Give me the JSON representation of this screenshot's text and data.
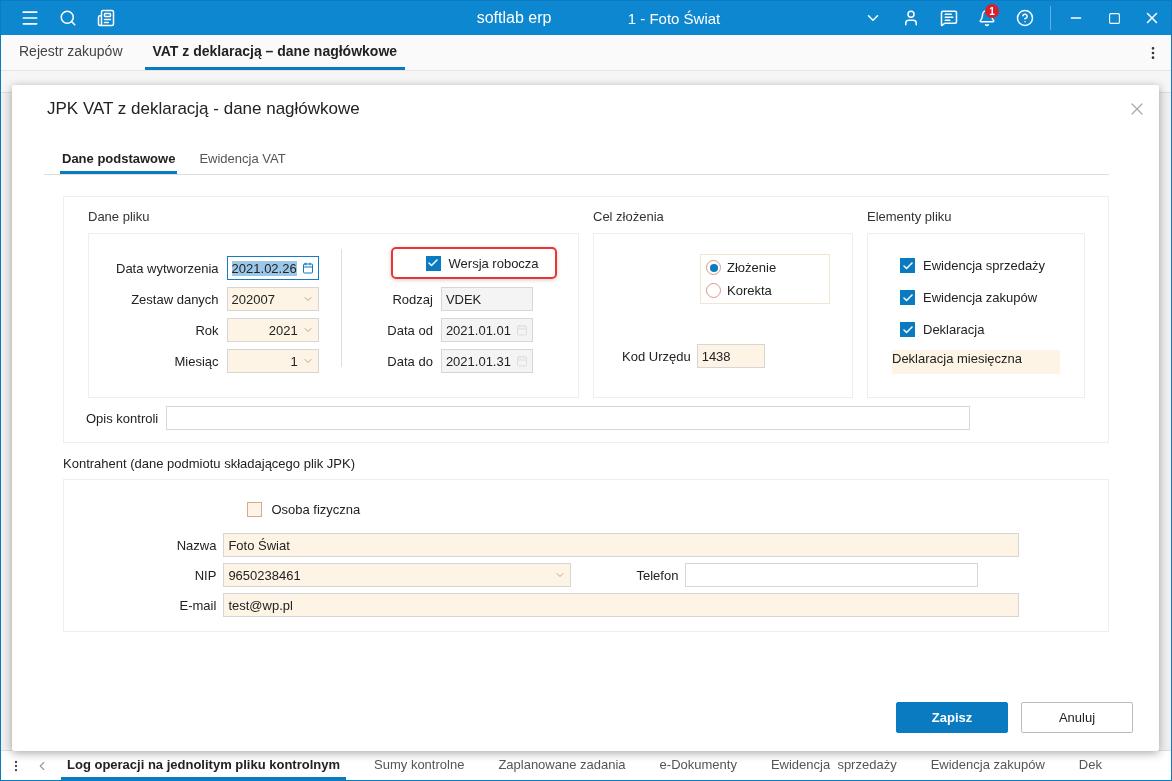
{
  "app": {
    "title": "softlab erp",
    "company": "1 - Foto Świat",
    "notification_count": "1"
  },
  "tabs": [
    {
      "label": "Rejestr zakupów",
      "selected": false
    },
    {
      "label": "VAT z deklaracją – dane nagłówkowe",
      "selected": true
    }
  ],
  "dialog": {
    "title": "JPK VAT z deklaracją - dane nagłówkowe",
    "tabs": [
      {
        "label": "Dane podstawowe",
        "selected": true
      },
      {
        "label": "Ewidencja VAT",
        "selected": false
      }
    ],
    "dane_pliku": {
      "title": "Dane pliku",
      "left_fields": [
        {
          "label": "Data wytworzenia",
          "value": "2021.02.26",
          "kind": "date",
          "highlighted": true
        },
        {
          "label": "Zestaw danych",
          "value": "202007",
          "kind": "select"
        },
        {
          "label": "Rok",
          "value": "2021",
          "kind": "number-select"
        },
        {
          "label": "Miesiąc",
          "value": "1",
          "kind": "number-select"
        }
      ],
      "draft": {
        "label": "Wersja robocza",
        "checked": true,
        "outlined": true
      },
      "right_fields": [
        {
          "label": "Rodzaj",
          "value": "VDEK",
          "kind": "text",
          "disabled": true
        },
        {
          "label": "Data od",
          "value": "2021.01.01",
          "kind": "date",
          "disabled": true
        },
        {
          "label": "Data do",
          "value": "2021.01.31",
          "kind": "date",
          "disabled": true
        }
      ]
    },
    "cel_zlozenia": {
      "title": "Cel złożenia",
      "options": [
        {
          "label": "Złożenie",
          "selected": true
        },
        {
          "label": "Korekta",
          "selected": false
        }
      ],
      "kod_urzedu": {
        "label": "Kod Urzędu",
        "value": "1438"
      }
    },
    "elementy_pliku": {
      "title": "Elementy pliku",
      "items": [
        {
          "label": "Ewidencja sprzedaży",
          "checked": true
        },
        {
          "label": "Ewidencja zakupów",
          "checked": true
        },
        {
          "label": "Deklaracja",
          "checked": true
        }
      ],
      "declaration_type": "Deklaracja miesięczna"
    },
    "opis_kontroli": {
      "label": "Opis kontroli"
    },
    "kontrahent": {
      "title": "Kontrahent (dane podmiotu składającego plik JPK)",
      "osoba_fizyczna": {
        "label": "Osoba fizyczna",
        "checked": false
      },
      "nazwa": {
        "label": "Nazwa",
        "value": "Foto Świat"
      },
      "nip": {
        "label": "NIP",
        "value": "9650238461"
      },
      "telefon": {
        "label": "Telefon"
      },
      "email": {
        "label": "E-mail",
        "value": "test@wp.pl"
      }
    },
    "buttons": [
      {
        "label": "Zapisz",
        "kind": "primary"
      },
      {
        "label": "Anuluj",
        "kind": "secondary"
      }
    ]
  },
  "bottom_tabs": [
    {
      "label": "Log operacji na jednolitym pliku kontrolnym",
      "selected": true
    },
    {
      "label": "Sumy kontrolne",
      "selected": false
    },
    {
      "label": "Zaplanowane zadania",
      "selected": false
    },
    {
      "label": "e-Dokumenty",
      "selected": false
    },
    {
      "label": "Ewidencja  sprzedaży",
      "selected": false
    },
    {
      "label": "Ewidencja zakupów",
      "selected": false
    },
    {
      "label": "Dek",
      "selected": false
    }
  ]
}
